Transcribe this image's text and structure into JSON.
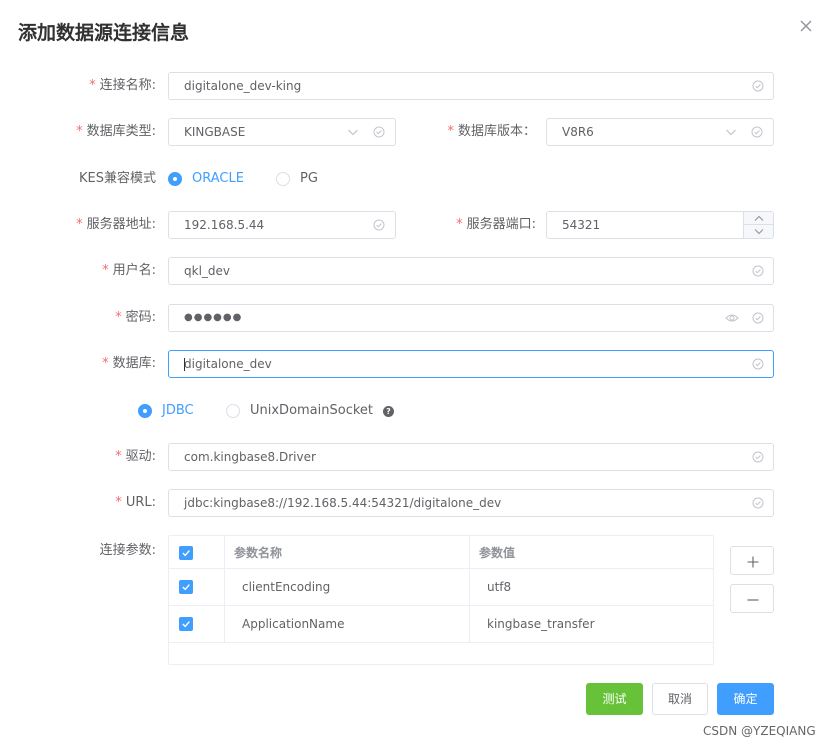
{
  "dialog": {
    "title": "添加数据源连接信息"
  },
  "form": {
    "name": {
      "label": "连接名称:",
      "value": "digitalone_dev-king"
    },
    "db_type": {
      "label": "数据库类型:",
      "value": "KINGBASE"
    },
    "db_version": {
      "label": "数据库版本：",
      "value": "V8R6"
    },
    "kes_mode": {
      "label": "KES兼容模式",
      "options": [
        "ORACLE",
        "PG"
      ],
      "selected": "ORACLE"
    },
    "host": {
      "label": "服务器地址:",
      "value": "192.168.5.44"
    },
    "port": {
      "label": "服务器端口:",
      "value": "54321"
    },
    "username": {
      "label": "用户名:",
      "value": "qkl_dev"
    },
    "password": {
      "label": "密码:",
      "value": "●●●●●●"
    },
    "database": {
      "label": "数据库:",
      "value": "digitalone_dev"
    },
    "conn_type": {
      "options": [
        "JDBC",
        "UnixDomainSocket"
      ],
      "selected": "JDBC",
      "help_icon": "?"
    },
    "driver": {
      "label": "驱动:",
      "value": "com.kingbase8.Driver"
    },
    "url": {
      "label": "URL:",
      "value": "jdbc:kingbase8://192.168.5.44:54321/digitalone_dev"
    },
    "params": {
      "label": "连接参数:",
      "headers": [
        "参数名称",
        "参数值"
      ],
      "rows": [
        {
          "name": "clientEncoding",
          "value": "utf8",
          "checked": true
        },
        {
          "name": "ApplicationName",
          "value": "kingbase_transfer",
          "checked": true
        }
      ]
    }
  },
  "buttons": {
    "test": "测试",
    "cancel": "取消",
    "confirm": "确定"
  },
  "watermark": "CSDN @YZEQIANG",
  "colors": {
    "primary": "#409eff",
    "success": "#67c23a",
    "required": "#f56c6c",
    "text": "#606266",
    "border": "#dcdfe6"
  },
  "icons": {
    "close": "close-icon",
    "valid": "circle-check-icon",
    "select": "chevron-down-icon",
    "password": "eye-icon",
    "add": "plus-icon",
    "remove": "minus-icon"
  }
}
